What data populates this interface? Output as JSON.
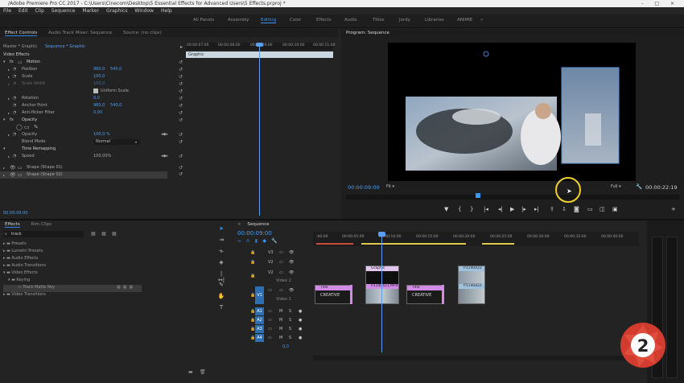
{
  "window": {
    "title": "/Adobe Premiere Pro CC 2017 - C:\\Users\\Cinecom\\Desktop\\5 Essential Effects for Advanced Users\\5 Effects.prproj *",
    "controls": "- □ ×"
  },
  "menu": [
    "File",
    "Edit",
    "Clip",
    "Sequence",
    "Marker",
    "Graphics",
    "Window",
    "Help"
  ],
  "workspaces": [
    "All Panels",
    "Assembly",
    "Editing",
    "Color",
    "Effects",
    "Audio",
    "Titles",
    "Jordy",
    "Libraries",
    "ANIMIE",
    "»"
  ],
  "source_tabs": {
    "effect_controls": "Effect Controls",
    "audio_mixer": "Audio Track Mixer: Sequence",
    "source": "Source: (no clips)"
  },
  "effect_controls": {
    "master": "Master * Graphic",
    "sequence": "Sequence * Graphic",
    "video_effects": "Video Effects",
    "clip_name": "Graphic",
    "ruler": [
      "00:00:07:00",
      "00:00:08:00",
      "00:00:09:00",
      "00:00:10:00",
      "00:00:11:00"
    ],
    "rows": [
      {
        "name": "fx",
        "label": "Motion",
        "v1": "",
        "v2": ""
      },
      {
        "name": "position",
        "label": "Position",
        "v1": "960,0",
        "v2": "540,0"
      },
      {
        "name": "scale",
        "label": "Scale",
        "v1": "100,0",
        "v2": ""
      },
      {
        "name": "scale-width",
        "label": "Scale Width",
        "v1": "100,0",
        "v2": ""
      },
      {
        "name": "uniform",
        "label": "Uniform Scale",
        "v1": "",
        "v2": ""
      },
      {
        "name": "rotation",
        "label": "Rotation",
        "v1": "0,0",
        "v2": ""
      },
      {
        "name": "anchor",
        "label": "Anchor Point",
        "v1": "960,0",
        "v2": "540,0"
      },
      {
        "name": "antiflicker",
        "label": "Anti-flicker Filter",
        "v1": "0,00",
        "v2": ""
      },
      {
        "name": "opacity-hdr",
        "label": "Opacity",
        "v1": "",
        "v2": ""
      },
      {
        "name": "opacity",
        "label": "Opacity",
        "v1": "100,0 %",
        "v2": ""
      },
      {
        "name": "blend",
        "label": "Blend Mode",
        "v1": "Normal",
        "v2": ""
      },
      {
        "name": "time-remap",
        "label": "Time Remapping",
        "v1": "",
        "v2": ""
      },
      {
        "name": "speed",
        "label": "Speed",
        "v1": "100,00%",
        "v2": ""
      },
      {
        "name": "shape1",
        "label": "Shape (Shape 01)",
        "v1": "",
        "v2": ""
      },
      {
        "name": "shape2",
        "label": "Shape (Shape 02)",
        "v1": "",
        "v2": ""
      }
    ],
    "timecode": "00:00:09:00"
  },
  "program": {
    "tab": "Program: Sequence",
    "timecode": "00:00:09:00",
    "fit": "Fit",
    "quality": "Full",
    "duration": "00:00:22:19"
  },
  "effects_panel": {
    "tabs": [
      "Effects",
      "Rim Clips"
    ],
    "search": "track",
    "tree": [
      {
        "label": "Presets",
        "indent": 0
      },
      {
        "label": "Lumetri Presets",
        "indent": 0
      },
      {
        "label": "Audio Effects",
        "indent": 0
      },
      {
        "label": "Audio Transitions",
        "indent": 0
      },
      {
        "label": "Video Effects",
        "indent": 0
      },
      {
        "label": "Keying",
        "indent": 1
      },
      {
        "label": "Track Matte Key",
        "indent": 2
      },
      {
        "label": "Video Transitions",
        "indent": 0
      }
    ]
  },
  "timeline": {
    "tab": "Sequence",
    "timecode": "00:00:09:00",
    "ruler": [
      ":00:00",
      "00:00:05:00",
      "00:00:10:00",
      "00:00:15:00",
      "00:00:20:00",
      "00:00:25:00",
      "00:00:30:00",
      "00:00:35:00",
      "00:00:40:00"
    ],
    "video_tracks": [
      "V3",
      "V2",
      "V1"
    ],
    "v2_name": "Video 2",
    "v1_name": "Video 1",
    "audio_tracks": [
      "A1",
      "A2",
      "A3",
      "A4"
    ],
    "master": "0,0",
    "clips": {
      "title": "Title",
      "graphic": "Graphic",
      "p1": "P1140421.MP4",
      "p2": "P1140422",
      "creative": "CREATIVE"
    }
  },
  "colors": {
    "accent": "#2d8ceb",
    "playhead": "#5aa0f0",
    "title_clip": "#d18ae6",
    "video_clip": "#9ec1de",
    "marker": "#e8c85a"
  }
}
